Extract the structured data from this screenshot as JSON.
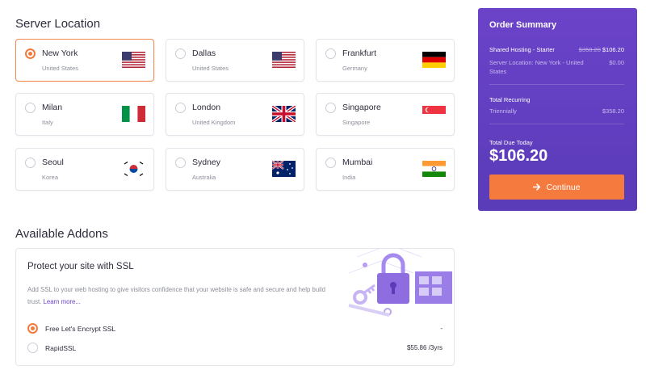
{
  "server_location": {
    "title": "Server Location",
    "locations": [
      {
        "city": "New York",
        "country": "United States",
        "flag": "us-flag",
        "selected": true
      },
      {
        "city": "Dallas",
        "country": "United States",
        "flag": "us-flag",
        "selected": false
      },
      {
        "city": "Frankfurt",
        "country": "Germany",
        "flag": "de-flag",
        "selected": false
      },
      {
        "city": "Milan",
        "country": "Italy",
        "flag": "it-flag",
        "selected": false
      },
      {
        "city": "London",
        "country": "United Kingdom",
        "flag": "uk-flag",
        "selected": false
      },
      {
        "city": "Singapore",
        "country": "Singapore",
        "flag": "sg-flag",
        "selected": false
      },
      {
        "city": "Seoul",
        "country": "Korea",
        "flag": "kr-flag",
        "selected": false
      },
      {
        "city": "Sydney",
        "country": "Australia",
        "flag": "au-flag",
        "selected": false
      },
      {
        "city": "Mumbai",
        "country": "India",
        "flag": "in-flag",
        "selected": false
      }
    ]
  },
  "order_summary": {
    "title": "Order Summary",
    "plan_label": "Shared Hosting - Starter",
    "plan_old_price": "$358.20",
    "plan_price": "$106.20",
    "location_label": "Server Location: New York - United States",
    "location_price": "$0.00",
    "recurring_label": "Total Recurring",
    "recurring_period": "Triennially",
    "recurring_price": "$358.20",
    "due_label": "Total Due Today",
    "due_amount": "$106.20",
    "continue_label": "Continue"
  },
  "addons": {
    "title": "Available Addons",
    "card_title": "Protect your site with SSL",
    "description": "Add SSL to your web hosting to give visitors confidence that your website is safe and secure and help build trust.",
    "learn_more": "Learn more...",
    "options": [
      {
        "label": "Free Let's Encrypt SSL",
        "price": "-",
        "selected": true
      },
      {
        "label": "RapidSSL",
        "price": "$55.86 /3yrs",
        "selected": false
      }
    ]
  },
  "colors": {
    "accent_orange": "#f37a3c",
    "summary_purple": "#6241c3"
  }
}
